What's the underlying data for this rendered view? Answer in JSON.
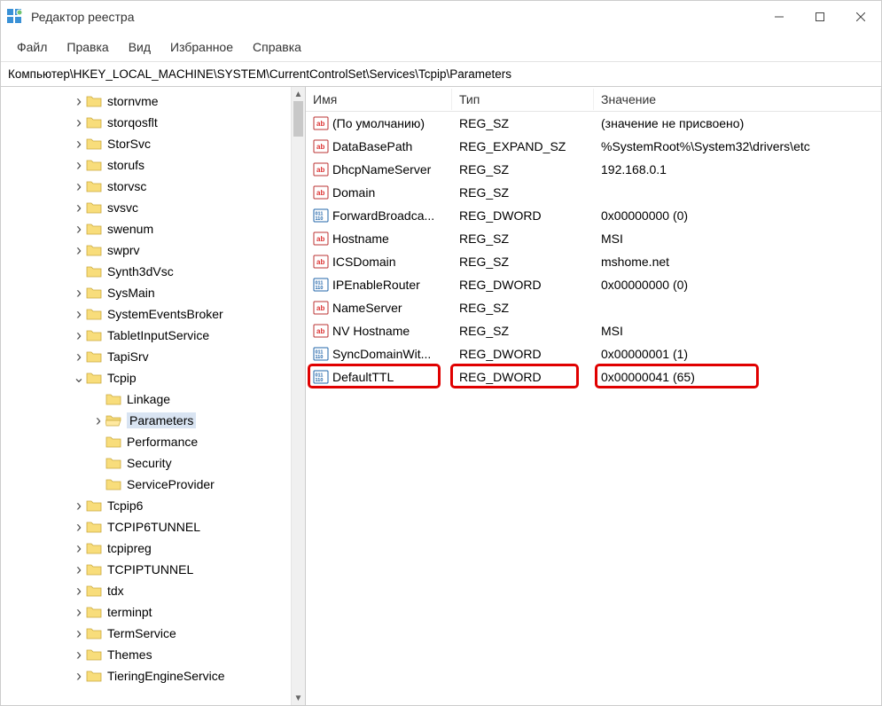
{
  "titlebar": {
    "title": "Редактор реестра"
  },
  "menu": {
    "file": "Файл",
    "edit": "Правка",
    "view": "Вид",
    "favorites": "Избранное",
    "help": "Справка"
  },
  "address": "Компьютер\\HKEY_LOCAL_MACHINE\\SYSTEM\\CurrentControlSet\\Services\\Tcpip\\Parameters",
  "tree": {
    "items": [
      {
        "label": "stornvme",
        "indent": 3,
        "twist": ">"
      },
      {
        "label": "storqosflt",
        "indent": 3,
        "twist": ">"
      },
      {
        "label": "StorSvc",
        "indent": 3,
        "twist": ">"
      },
      {
        "label": "storufs",
        "indent": 3,
        "twist": ">"
      },
      {
        "label": "storvsc",
        "indent": 3,
        "twist": ">"
      },
      {
        "label": "svsvc",
        "indent": 3,
        "twist": ">"
      },
      {
        "label": "swenum",
        "indent": 3,
        "twist": ">"
      },
      {
        "label": "swprv",
        "indent": 3,
        "twist": ">"
      },
      {
        "label": "Synth3dVsc",
        "indent": 3,
        "twist": ""
      },
      {
        "label": "SysMain",
        "indent": 3,
        "twist": ">"
      },
      {
        "label": "SystemEventsBroker",
        "indent": 3,
        "twist": ">"
      },
      {
        "label": "TabletInputService",
        "indent": 3,
        "twist": ">"
      },
      {
        "label": "TapiSrv",
        "indent": 3,
        "twist": ">"
      },
      {
        "label": "Tcpip",
        "indent": 3,
        "twist": "v"
      },
      {
        "label": "Linkage",
        "indent": 4,
        "twist": ""
      },
      {
        "label": "Parameters",
        "indent": 4,
        "twist": ">",
        "selected": true
      },
      {
        "label": "Performance",
        "indent": 4,
        "twist": ""
      },
      {
        "label": "Security",
        "indent": 4,
        "twist": ""
      },
      {
        "label": "ServiceProvider",
        "indent": 4,
        "twist": ""
      },
      {
        "label": "Tcpip6",
        "indent": 3,
        "twist": ">"
      },
      {
        "label": "TCPIP6TUNNEL",
        "indent": 3,
        "twist": ">"
      },
      {
        "label": "tcpipreg",
        "indent": 3,
        "twist": ">"
      },
      {
        "label": "TCPIPTUNNEL",
        "indent": 3,
        "twist": ">"
      },
      {
        "label": "tdx",
        "indent": 3,
        "twist": ">"
      },
      {
        "label": "terminpt",
        "indent": 3,
        "twist": ">"
      },
      {
        "label": "TermService",
        "indent": 3,
        "twist": ">"
      },
      {
        "label": "Themes",
        "indent": 3,
        "twist": ">"
      },
      {
        "label": "TieringEngineService",
        "indent": 3,
        "twist": ">"
      }
    ]
  },
  "list": {
    "headers": {
      "name": "Имя",
      "type": "Тип",
      "value": "Значение"
    },
    "rows": [
      {
        "icon": "sz",
        "name": "(По умолчанию)",
        "type": "REG_SZ",
        "value": "(значение не присвоено)"
      },
      {
        "icon": "sz",
        "name": "DataBasePath",
        "type": "REG_EXPAND_SZ",
        "value": "%SystemRoot%\\System32\\drivers\\etc"
      },
      {
        "icon": "sz",
        "name": "DhcpNameServer",
        "type": "REG_SZ",
        "value": "192.168.0.1"
      },
      {
        "icon": "sz",
        "name": "Domain",
        "type": "REG_SZ",
        "value": ""
      },
      {
        "icon": "dw",
        "name": "ForwardBroadca...",
        "type": "REG_DWORD",
        "value": "0x00000000 (0)"
      },
      {
        "icon": "sz",
        "name": "Hostname",
        "type": "REG_SZ",
        "value": "MSI"
      },
      {
        "icon": "sz",
        "name": "ICSDomain",
        "type": "REG_SZ",
        "value": "mshome.net"
      },
      {
        "icon": "dw",
        "name": "IPEnableRouter",
        "type": "REG_DWORD",
        "value": "0x00000000 (0)"
      },
      {
        "icon": "sz",
        "name": "NameServer",
        "type": "REG_SZ",
        "value": ""
      },
      {
        "icon": "sz",
        "name": "NV Hostname",
        "type": "REG_SZ",
        "value": "MSI"
      },
      {
        "icon": "dw",
        "name": "SyncDomainWit...",
        "type": "REG_DWORD",
        "value": "0x00000001 (1)"
      },
      {
        "icon": "dw",
        "name": "DefaultTTL",
        "type": "REG_DWORD",
        "value": "0x00000041 (65)",
        "highlighted": true
      }
    ]
  }
}
